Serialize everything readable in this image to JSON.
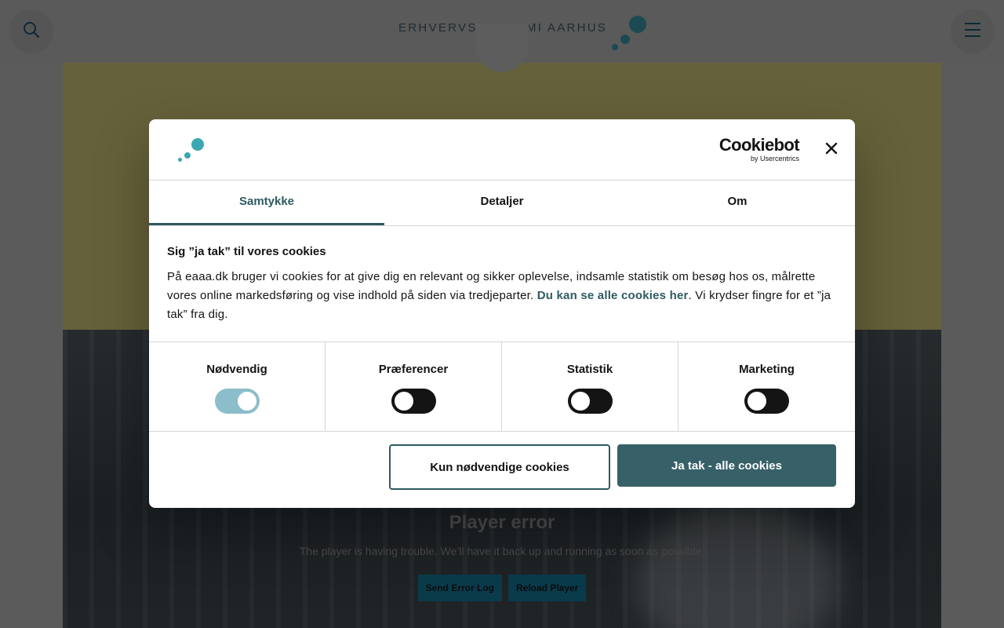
{
  "header": {
    "logo_text": "ERHVERVSAKADEMI AARHUS",
    "search_icon": "search-icon",
    "menu_icon": "hamburger-menu-icon"
  },
  "video": {
    "error_title": "Player error",
    "error_message": "The player is having trouble. We’ll have it back up and running as soon as possible.",
    "send_log_label": "Send Error Log",
    "reload_label": "Reload Player"
  },
  "dialog": {
    "brand": {
      "name": "Cookiebot",
      "sub": "by Usercentrics"
    },
    "close_icon": "close-icon",
    "tabs": [
      {
        "label": "Samtykke",
        "active": true
      },
      {
        "label": "Detaljer",
        "active": false
      },
      {
        "label": "Om",
        "active": false
      }
    ],
    "heading": "Sig ”ja tak” til vores cookies",
    "body_part1": "På eaaa.dk bruger vi cookies for at give dig en relevant og sikker oplevelse, indsamle statistik om besøg hos os, målrette vores online markedsføring og vise indhold på siden via tredjeparter. ",
    "body_link": "Du kan se alle cookies her",
    "body_part2": ". Vi krydser fingre for et ”ja tak” fra dig.",
    "toggles": [
      {
        "label": "Nødvendig",
        "on": true
      },
      {
        "label": "Præferencer",
        "on": false
      },
      {
        "label": "Statistik",
        "on": false
      },
      {
        "label": "Marketing",
        "on": false
      }
    ],
    "btn_necessary": "Kun nødvendige cookies",
    "btn_accept_all": "Ja tak - alle cookies"
  },
  "colors": {
    "accent": "#2e5a62",
    "accept_button": "#376068",
    "toggle_on": "#8cbdca",
    "toggle_off": "#141414",
    "brand_dot": "#3aa8b0"
  }
}
